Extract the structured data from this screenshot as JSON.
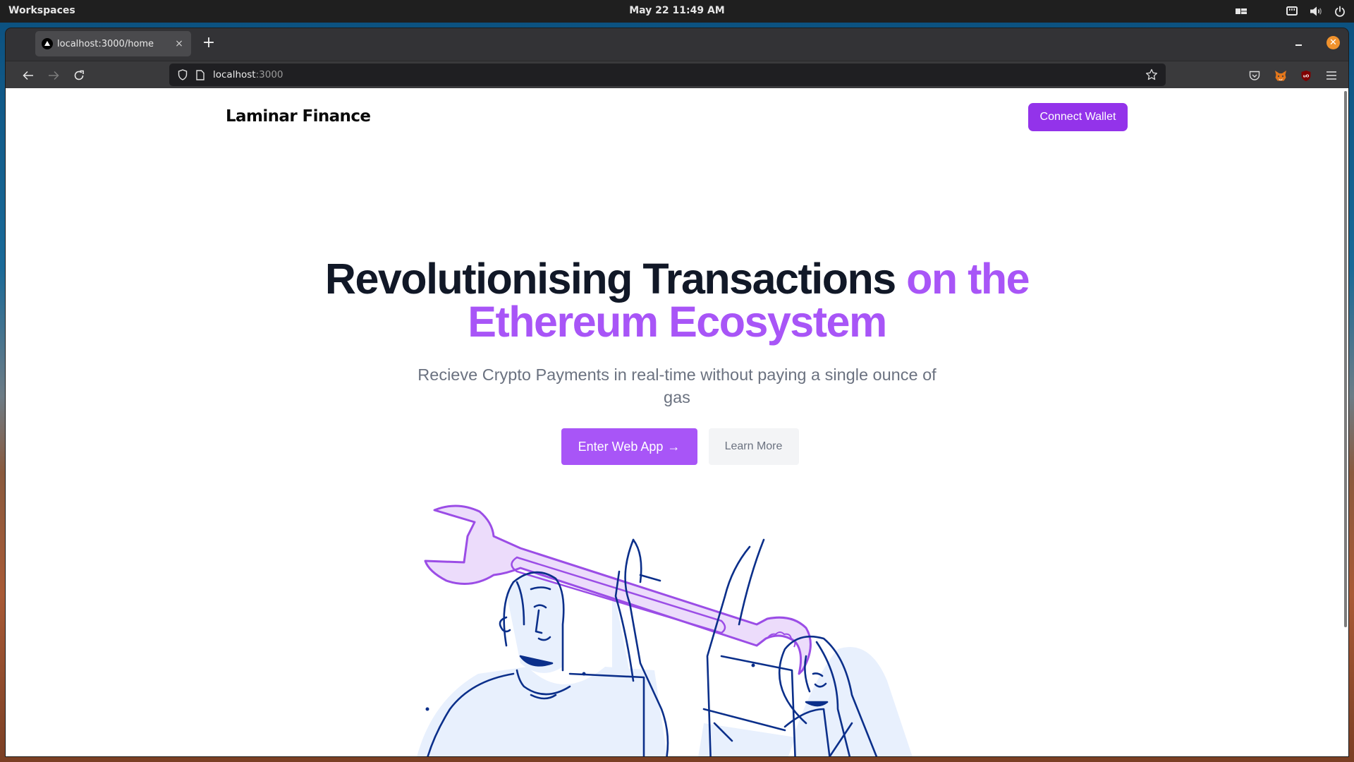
{
  "os": {
    "workspaces_label": "Workspaces",
    "clock": "May 22  11:49 AM",
    "tray_icons": [
      "layout-icon",
      "network-icon",
      "volume-icon",
      "power-icon"
    ]
  },
  "browser": {
    "tab": {
      "title": "localhost:3000/home",
      "favicon": "triangle-icon"
    },
    "new_tab_label": "+",
    "close_label": "×",
    "window_close_label": "✕",
    "url": {
      "host": "localhost",
      "port": ":3000"
    },
    "extensions": [
      "pocket-icon",
      "metamask-icon",
      "ublock-origin-icon",
      "menu-icon"
    ]
  },
  "page": {
    "brand": "Laminar Finance",
    "connect_wallet": "Connect Wallet",
    "hero": {
      "title_main": "Revolutionising Transactions ",
      "title_accent_1": "on the",
      "title_accent_2": "Ethereum Ecosystem",
      "subtitle": "Recieve Crypto Payments in real-time without paying a single ounce of gas"
    },
    "cta_primary": "Enter Web App",
    "cta_primary_arrow": "→",
    "cta_secondary": "Learn More",
    "illustration": "two-people-holding-wrench"
  },
  "colors": {
    "accent_purple": "#9333ea",
    "accent_light_purple": "#a855f7",
    "heading": "#111827",
    "muted_text": "#6b7280",
    "secondary_btn_bg": "#f3f4f6",
    "illustration_line": "#0b2f8a"
  }
}
